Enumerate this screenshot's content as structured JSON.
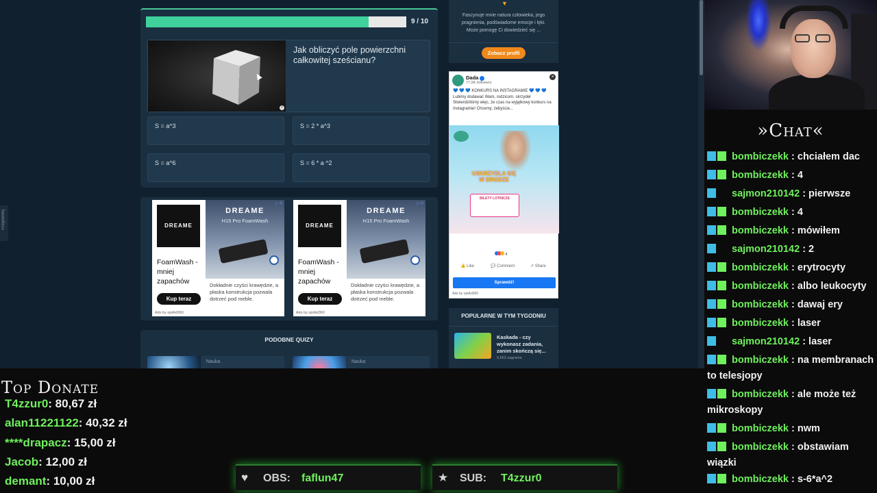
{
  "quiz": {
    "progress_text": "9 / 10",
    "progress_fraction": 0.9,
    "question": "Jak obliczyć pole powierzchni całkowitej sześcianu?",
    "answers": [
      "S = a^3",
      "S = 2 * a^3",
      "S = a^6",
      "S = 6 * a ^2"
    ]
  },
  "left_tab_label": "Przypomnij",
  "ads": [
    {
      "logo": "DREAME",
      "copy": "FoamWash - mniej zapachów",
      "button": "Kup teraz",
      "brand": "DREAME",
      "product": "H15 Pro FoamWash",
      "desc": "Dokładnie czyści krawędzie, a płaska konstrukcja pozwala dotrzeć pod meble.",
      "foot": "Ads by optAd360"
    },
    {
      "logo": "DREAME",
      "copy": "FoamWash - mniej zapachów",
      "button": "Kup teraz",
      "brand": "DREAME",
      "product": "H15 Pro FoamWash",
      "desc": "Dokładnie czyści krawędzie, a płaska konstrukcja pozwala dotrzeć pod meble.",
      "foot": "Ads by optAd360"
    }
  ],
  "similar": {
    "title": "PODOBNE QUIZY",
    "tiles": [
      {
        "category": "Nauka"
      },
      {
        "category": "Nauka"
      }
    ]
  },
  "profile": {
    "text": "Fascynuje mnie natura człowieka, jego pragnienia, podświadome emocje i lęki. Może pomogę Ci dowiedzieć się ...",
    "button": "Zobacz profil"
  },
  "fb_ad": {
    "name": "Dada",
    "followers": "77,9K followers",
    "text": "💙 💙 💙 KONKURS NA INSTAGRAMIE 💙 💙 💙 Lubimy dodawać Wam, rodzicom, skrzydeł Stwierdziliśmy więc, że czas na wyjątkowy konkurs na Instagramie! Chcemy, żebyście...",
    "hero_text": "USKRZYDLA SIĘ W DRODZE",
    "ticket_text": "BILETY LOTNICZE",
    "reactions": "4",
    "like": "Like",
    "comment": "Comment",
    "share": "Share",
    "button": "Sprawdź!",
    "foot": "Ads by optAd360"
  },
  "popular": {
    "title": "POPULARNE W TYM TYGODNIU",
    "item_title": "Kaskada - czy wykonasz zadania, zanim skończą się...",
    "item_sub": "9,663 zagrania"
  },
  "chat": {
    "title": "»Chat«",
    "messages": [
      {
        "user": "bombiczekk",
        "text": ": chciałem dac",
        "badges": 2
      },
      {
        "user": "bombiczekk",
        "text": ": 4",
        "badges": 2
      },
      {
        "user": "sajmon210142",
        "text": ": pierwsze",
        "badges": 1
      },
      {
        "user": "bombiczekk",
        "text": ": 4",
        "badges": 2
      },
      {
        "user": "bombiczekk",
        "text": ": mówiłem",
        "badges": 2
      },
      {
        "user": "sajmon210142",
        "text": ": 2",
        "badges": 1
      },
      {
        "user": "bombiczekk",
        "text": ": erytrocyty",
        "badges": 2
      },
      {
        "user": "bombiczekk",
        "text": ": albo leukocyty",
        "badges": 2
      },
      {
        "user": "bombiczekk",
        "text": ": dawaj ery",
        "badges": 2
      },
      {
        "user": "bombiczekk",
        "text": ": laser",
        "badges": 2
      },
      {
        "user": "sajmon210142",
        "text": ": laser",
        "badges": 1
      },
      {
        "user": "bombiczekk",
        "text": ": na membranach to telesjopy",
        "badges": 2
      },
      {
        "user": "bombiczekk",
        "text": ": ale może też mikroskopy",
        "badges": 2
      },
      {
        "user": "bombiczekk",
        "text": ": nwm",
        "badges": 2
      },
      {
        "user": "bombiczekk",
        "text": ": obstawiam wiązki",
        "badges": 2
      },
      {
        "user": "bombiczekk",
        "text": ": s-6*a^2",
        "badges": 2
      }
    ]
  },
  "donate": {
    "title": "Top Donate",
    "rows": [
      {
        "name": "T4zzur0",
        "amount": ": 80,67 zł"
      },
      {
        "name": "alan11221122",
        "amount": ": 40,32 zł"
      },
      {
        "name": "****drapacz",
        "amount": ": 15,00 zł"
      },
      {
        "name": "Jacob",
        "amount": ": 12,00 zł"
      },
      {
        "name": "demant",
        "amount": ": 10,00 zł"
      }
    ]
  },
  "obs": {
    "label": "OBS:",
    "value": "faflun47"
  },
  "sub": {
    "label": "SUB:",
    "value": "T4zzur0"
  },
  "colors": {
    "accent_green": "#6ff05d",
    "progress": "#3fd29c",
    "profile_button": "#f0891b",
    "fb_blue": "#1877f2"
  }
}
